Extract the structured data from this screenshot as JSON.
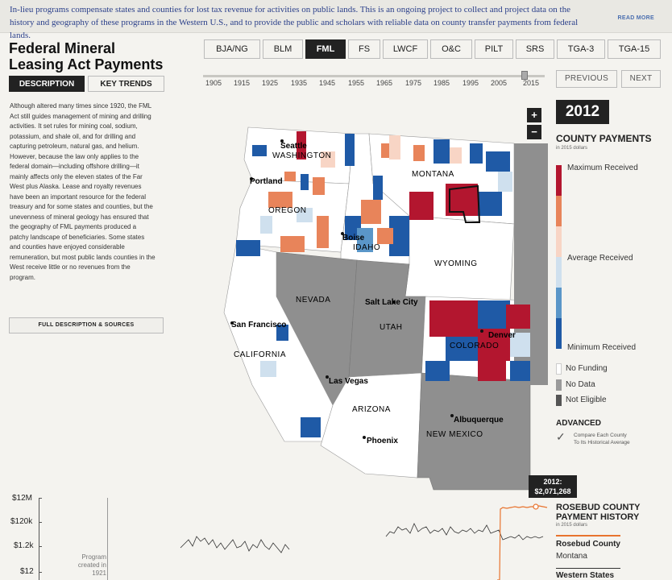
{
  "intro": {
    "text": "In-lieu programs compensate states and counties for lost tax revenue for activities on public lands. This is an ongoing project to collect and project data on the history and geography of these programs in the Western U.S., and to provide the public and scholars with reliable data on county transfer payments from federal lands.",
    "read_more": "READ MORE"
  },
  "page_title": "Federal Mineral Leasing Act Payments",
  "tabs": [
    {
      "label": "DESCRIPTION",
      "active": true
    },
    {
      "label": "KEY TRENDS",
      "active": false
    }
  ],
  "description": "Although altered many times since 1920, the FML Act still guides management of mining and drilling activities. It set rules for mining coal, sodium, potassium, and shale oil, and for drilling and capturing petroleum, natural gas, and helium. However, because the law only applies to the federal domain—including offshore drilling—it mainly affects only the eleven states of the Far West plus Alaska. Lease and royalty revenues have been an important resource for the federal treasury and for some states and counties, but the unevenness of mineral geology has ensured that the geography of FML payments produced a patchy landscape of beneficiaries. Some states and counties have enjoyed considerable remuneration, but most public lands counties in the West receive little or no revenues from the program.",
  "full_description_button": "FULL DESCRIPTION & SOURCES",
  "programs": [
    {
      "label": "BJA/NG",
      "active": false
    },
    {
      "label": "BLM",
      "active": false
    },
    {
      "label": "FML",
      "active": true
    },
    {
      "label": "FS",
      "active": false
    },
    {
      "label": "LWCF",
      "active": false
    },
    {
      "label": "O&C",
      "active": false
    },
    {
      "label": "PILT",
      "active": false
    },
    {
      "label": "SRS",
      "active": false
    },
    {
      "label": "TGA-3",
      "active": false
    },
    {
      "label": "TGA-15",
      "active": false
    }
  ],
  "timeline": {
    "years": [
      "1905",
      "1915",
      "1925",
      "1935",
      "1945",
      "1955",
      "1965",
      "1975",
      "1985",
      "1995",
      "2005",
      "2015"
    ],
    "selected_year": 2012
  },
  "nav": {
    "previous": "PREVIOUS",
    "next": "NEXT"
  },
  "year_badge": "2012",
  "legend": {
    "title": "COUNTY PAYMENTS",
    "subtitle": "in 2015 dollars",
    "max_label": "Maximum Received",
    "avg_label": "Average Received",
    "min_label": "Minimum Received",
    "scale_colors": [
      "#b3162f",
      "#e8845a",
      "#f8d5c5",
      "#cfe0ee",
      "#5a96c8",
      "#1f5aa6"
    ],
    "categories": [
      {
        "label": "No Funding",
        "color": "#ffffff"
      },
      {
        "label": "No Data",
        "color": "#9a9a9a"
      },
      {
        "label": "Not Eligible",
        "color": "#555555"
      }
    ]
  },
  "advanced": {
    "title": "ADVANCED",
    "option_line1": "Compare Each County",
    "option_line2": "To Its Historical Average",
    "checked": true
  },
  "map": {
    "zoom_in": "+",
    "zoom_out": "−",
    "states": [
      "WASHINGTON",
      "OREGON",
      "IDAHO",
      "MONTANA",
      "WYOMING",
      "NEVADA",
      "UTAH",
      "COLORADO",
      "CALIFORNIA",
      "ARIZONA",
      "NEW MEXICO"
    ],
    "cities": [
      "Seattle",
      "Portland",
      "Boise",
      "Salt Lake City",
      "Denver",
      "San Francisco",
      "Las Vegas",
      "Albuquerque",
      "Phoenix"
    ]
  },
  "history": {
    "y_axis": [
      "$12M",
      "$120k",
      "$1.2k",
      "$12"
    ],
    "program_note": [
      "Program",
      "created in",
      "1921"
    ],
    "tooltip_year": "2012:",
    "tooltip_value": "$2,071,268",
    "title_line1": "ROSEBUD COUNTY",
    "title_line2": "PAYMENT HISTORY",
    "subtitle": "in 2015 dollars",
    "series": [
      {
        "name": "Rosebud County",
        "sub": "Montana",
        "color": "#e8732e"
      },
      {
        "name": "Western States",
        "sub": "",
        "color": "#333333"
      }
    ]
  }
}
